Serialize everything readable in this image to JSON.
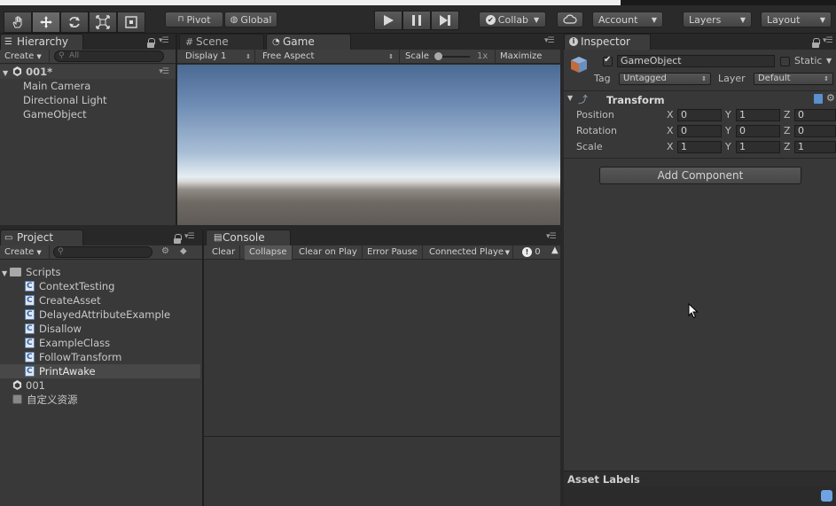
{
  "toolbar": {
    "pivot": "Pivot",
    "global": "Global",
    "collab": "Collab",
    "account": "Account",
    "layers": "Layers",
    "layout": "Layout"
  },
  "hierarchy": {
    "tab": "Hierarchy",
    "create": "Create",
    "search_placeholder": "All",
    "scene": "001*",
    "items": [
      "Main Camera",
      "Directional Light",
      "GameObject"
    ]
  },
  "scene_tab": "Scene",
  "game": {
    "tab": "Game",
    "display": "Display 1",
    "aspect": "Free Aspect",
    "scale_label": "Scale",
    "scale_value": "1x",
    "maximize": "Maximize On"
  },
  "project": {
    "tab": "Project",
    "create": "Create",
    "folder": "Scripts",
    "scripts": [
      "ContextTesting",
      "CreateAsset",
      "DelayedAttributeExample",
      "Disallow",
      "ExampleClass",
      "FollowTransform",
      "PrintAwake"
    ],
    "selected": "PrintAwake",
    "scene_asset": "001",
    "custom_asset": "自定义资源"
  },
  "console": {
    "tab": "Console",
    "clear": "Clear",
    "collapse": "Collapse",
    "clear_on_play": "Clear on Play",
    "error_pause": "Error Pause",
    "connected_player": "Connected Playe",
    "count": "0"
  },
  "inspector": {
    "tab": "Inspector",
    "name": "GameObject",
    "static_label": "Static",
    "tag_label": "Tag",
    "tag_value": "Untagged",
    "layer_label": "Layer",
    "layer_value": "Default",
    "transform_title": "Transform",
    "position": {
      "label": "Position",
      "x": "0",
      "y": "1",
      "z": "0"
    },
    "rotation": {
      "label": "Rotation",
      "x": "0",
      "y": "0",
      "z": "0"
    },
    "scale": {
      "label": "Scale",
      "x": "1",
      "y": "1",
      "z": "1"
    },
    "axis_x": "X",
    "axis_y": "Y",
    "axis_z": "Z",
    "add_component": "Add Component",
    "asset_labels": "Asset Labels"
  }
}
